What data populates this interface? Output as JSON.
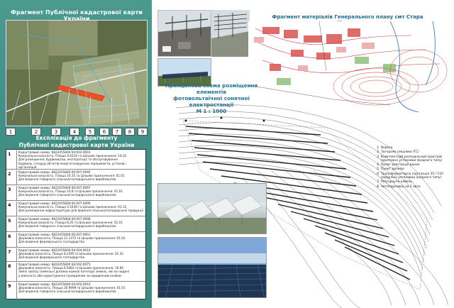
{
  "left_panel": {
    "title": "Фрагмент Публічної кадастрової карти України",
    "map_numbers": [
      "1",
      "2",
      "3",
      "4",
      "5",
      "6",
      "7",
      "8",
      "9"
    ],
    "explication_title": "Експлікація до фрагменту\nПублічної кадастрової карти України",
    "rows": [
      {
        "num": "1",
        "text": "Кадастровий номер: 6822455800:04:002:0003\nКомунальна власність.  Площа 0.6224 га Цільове призначення: 14.01\nДля розміщення, будівництва, експлуатації та обслуговування\nбудівель і споруд об'єктів енергогенеруючих підприємств, установ і організацій"
      },
      {
        "num": "2",
        "text": "Кадастровий номер: 6822455800:00:007:0095\nКомунальна власність.  Площа 10.35 га Цільове призначення: 01.01\nДля ведення товарного сільськогосподарського виробництва"
      },
      {
        "num": "3",
        "text": "Кадастровий номер: 6822455800:00:007:0097\nКомунальна власність.  Площа 10.8 га Цільове призначення: 01.01\nДля ведення товарного сільськогосподарського виробництва"
      },
      {
        "num": "4",
        "text": "Кадастровий номер: 6822455800:00:007:0096\nКомунальна власність.  Площа 0.1639 га Цільове призначення: 01.12\nДля розміщення інфраструктури для ведення сільськогосподарської продукції"
      },
      {
        "num": "5",
        "text": "Кадастровий номер: 6822455800:00:007:0098\nКомунальна власність.  Площа 8.25 га Цільове призначення: 01.01\nДля ведення товарного сільськогосподарського виробництва"
      },
      {
        "num": "6",
        "text": "Кадастровий номер: 6822455800:00:007:0001\nДержавна власність.  Площа 11.1372 га  Цільове призначення: 01.02\nДля ведення фермерського господарства"
      },
      {
        "num": "7",
        "text": "Кадастровий номер: 6822455800:04:004:0010\nДержавна власність.  Площа 8.2395 га Цільове призначення: 01.32\nДля ведення фермерського господарства"
      },
      {
        "num": "8",
        "text": "Кадастровий номер: 6822455800:04:002:0075\nДержавна власність.  Площа 6.6462 га  Цільове призначення: 16.00\nЗемлі запасу (земельні ділянки кожної категорії земель, які не надані\nу власність або користування громадянам чи юридичним особам"
      },
      {
        "num": "9",
        "text": "Кадастровий номер: 6822455800:04:002:0010\nДержавна власність.  Площа 30.9999 га  Цільове призначення: 01.01\nДля ведення товарного сільськогосподарського виробництва"
      }
    ]
  },
  "genplan": {
    "title": "Фрагмент матеріалів Генерального плану смт Стара Ушиця"
  },
  "scheme": {
    "title": "Принципова схема розміщення елементів\nфотовольтаїчної сонячної електростанції\nМ 1 : 1000"
  },
  "legend": [
    {
      "n": "1",
      "t": "Ворота"
    },
    {
      "n": "2",
      "t": "Загорожі секціями (ТС)"
    },
    {
      "n": "3",
      "t": "Комплектний розподільчий пристрій (монтажні установки (вхідного типу)"
    },
    {
      "n": "4",
      "t": "Пункт реєстрації даних"
    },
    {
      "n": "5",
      "t": "Пункт дизелю"
    },
    {
      "n": "6",
      "t": "Трансформаторна підстанція 35 / 110 (модульні установки (вхідного типу)"
    },
    {
      "n": "7",
      "t": "Розгорнути кабель"
    },
    {
      "n": "8",
      "t": "Автопарковка на 2 авто"
    }
  ],
  "colors": {
    "panel_green": "#3f8f86",
    "title_blue": "#1f6f9a",
    "parcel_highlight": "#e8502a"
  }
}
